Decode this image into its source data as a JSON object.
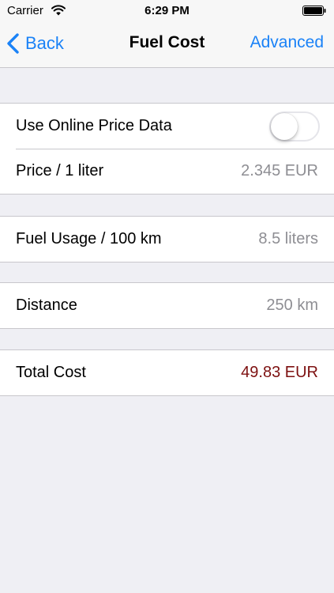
{
  "status_bar": {
    "carrier": "Carrier",
    "time": "6:29 PM"
  },
  "nav": {
    "back_label": "Back",
    "title": "Fuel Cost",
    "right_label": "Advanced"
  },
  "price_section": {
    "online_label": "Use Online Price Data",
    "online_enabled": false,
    "price_label": "Price / 1 liter",
    "price_value": "2.345 EUR"
  },
  "usage_section": {
    "label": "Fuel Usage / 100 km",
    "value": "8.5 liters"
  },
  "distance_section": {
    "label": "Distance",
    "value": "250 km"
  },
  "total_section": {
    "label": "Total Cost",
    "value": "49.83 EUR"
  },
  "colors": {
    "accent": "#1a82f7",
    "total_value": "#7d1010",
    "secondary_text": "#8e8e93",
    "background": "#efeff4"
  }
}
